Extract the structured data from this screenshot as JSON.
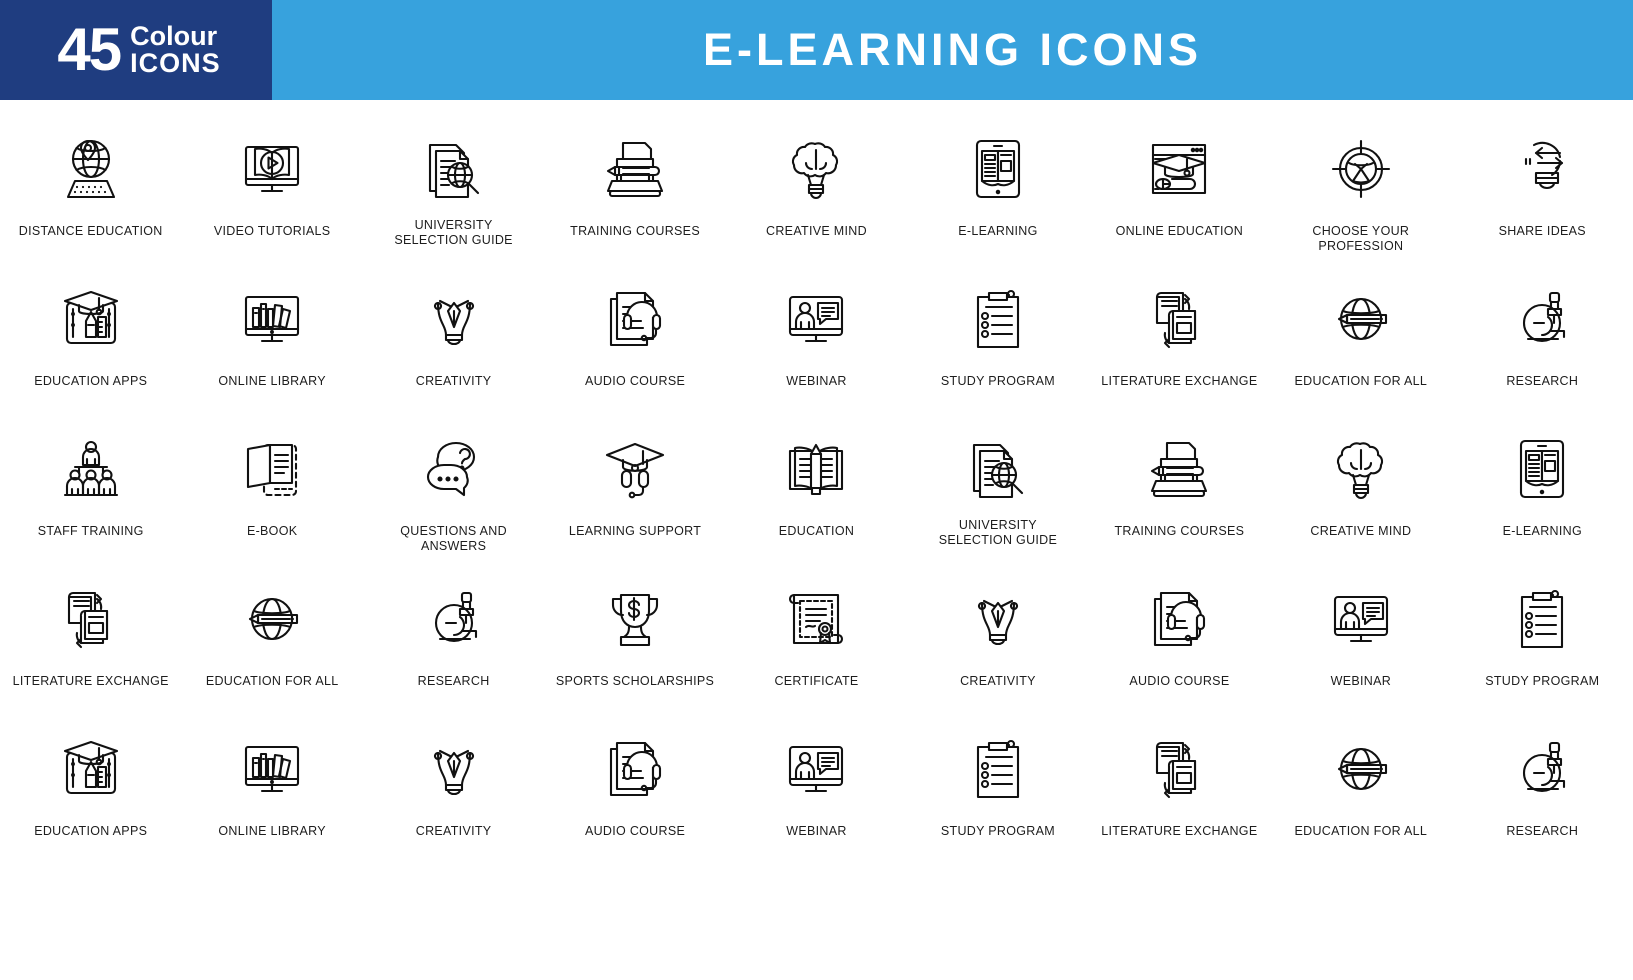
{
  "header": {
    "badge_number": "45",
    "badge_line1": "Colour",
    "badge_line2": "ICONS",
    "title": "E-LEARNING ICONS",
    "badge_bg": "#1f3d80",
    "title_bg": "#37a2dd",
    "title_color": "#ffffff"
  },
  "grid": {
    "columns": 9,
    "rows": 5,
    "icon_stroke_color": "#111111"
  },
  "icons": [
    {
      "label": "DISTANCE EDUCATION",
      "icon": "globe-keyboard-icon"
    },
    {
      "label": "VIDEO TUTORIALS",
      "icon": "book-play-monitor-icon"
    },
    {
      "label": "UNIVERSITY\nSELECTION GUIDE",
      "icon": "documents-magnifier-icon"
    },
    {
      "label": "TRAINING COURSES",
      "icon": "typewriter-pencil-icon"
    },
    {
      "label": "CREATIVE MIND",
      "icon": "brain-bulb-icon"
    },
    {
      "label": "E-LEARNING",
      "icon": "tablet-open-book-icon"
    },
    {
      "label": "ONLINE EDUCATION",
      "icon": "browser-graduation-cap-icon"
    },
    {
      "label": "CHOOSE YOUR PROFESSION",
      "icon": "target-crosshair-icon"
    },
    {
      "label": "SHARE IDEAS",
      "icon": "bulb-arrows-icon"
    },
    {
      "label": "EDUCATION APPS",
      "icon": "graduation-cap-tablet-icon"
    },
    {
      "label": "ONLINE LIBRARY",
      "icon": "monitor-books-icon"
    },
    {
      "label": "CREATIVITY",
      "icon": "bulb-pen-nib-icon"
    },
    {
      "label": "AUDIO COURSE",
      "icon": "documents-headset-icon"
    },
    {
      "label": "WEBINAR",
      "icon": "monitor-speaker-chat-icon"
    },
    {
      "label": "STUDY PROGRAM",
      "icon": "clipboard-checklist-icon"
    },
    {
      "label": "LITERATURE EXCHANGE",
      "icon": "books-exchange-icon"
    },
    {
      "label": "EDUCATION FOR ALL",
      "icon": "globe-pencil-icon"
    },
    {
      "label": "RESEARCH",
      "icon": "microscope-icon"
    },
    {
      "label": "STAFF TRAINING",
      "icon": "people-podium-icon"
    },
    {
      "label": "E-BOOK",
      "icon": "ebook-reader-icon"
    },
    {
      "label": "QUESTIONS AND ANSWERS",
      "icon": "speech-bubbles-question-icon"
    },
    {
      "label": "LEARNING SUPPORT",
      "icon": "graduation-cap-headset-icon"
    },
    {
      "label": "EDUCATION",
      "icon": "open-book-pencil-icon"
    },
    {
      "label": "UNIVERSITY\nSELECTION GUIDE",
      "icon": "documents-magnifier-icon"
    },
    {
      "label": "TRAINING COURSES",
      "icon": "typewriter-pencil-icon"
    },
    {
      "label": "CREATIVE MIND",
      "icon": "brain-bulb-icon"
    },
    {
      "label": "E-LEARNING",
      "icon": "tablet-open-book-icon"
    },
    {
      "label": "LITERATURE EXCHANGE",
      "icon": "books-exchange-icon"
    },
    {
      "label": "EDUCATION FOR ALL",
      "icon": "globe-pencil-icon"
    },
    {
      "label": "RESEARCH",
      "icon": "microscope-icon"
    },
    {
      "label": "SPORTS SCHOLARSHIPS",
      "icon": "trophy-dollar-icon"
    },
    {
      "label": "CERTIFICATE",
      "icon": "certificate-scroll-icon"
    },
    {
      "label": "CREATIVITY",
      "icon": "bulb-pen-nib-icon"
    },
    {
      "label": "AUDIO COURSE",
      "icon": "documents-headset-icon"
    },
    {
      "label": "WEBINAR",
      "icon": "monitor-speaker-chat-icon"
    },
    {
      "label": "STUDY PROGRAM",
      "icon": "clipboard-checklist-icon"
    },
    {
      "label": "EDUCATION APPS",
      "icon": "graduation-cap-tablet-icon"
    },
    {
      "label": "ONLINE LIBRARY",
      "icon": "monitor-books-icon"
    },
    {
      "label": "CREATIVITY",
      "icon": "bulb-pen-nib-icon"
    },
    {
      "label": "AUDIO COURSE",
      "icon": "documents-headset-icon"
    },
    {
      "label": "WEBINAR",
      "icon": "monitor-speaker-chat-icon"
    },
    {
      "label": "STUDY PROGRAM",
      "icon": "clipboard-checklist-icon"
    },
    {
      "label": "LITERATURE EXCHANGE",
      "icon": "books-exchange-icon"
    },
    {
      "label": "EDUCATION FOR ALL",
      "icon": "globe-pencil-icon"
    },
    {
      "label": "RESEARCH",
      "icon": "microscope-icon"
    }
  ]
}
